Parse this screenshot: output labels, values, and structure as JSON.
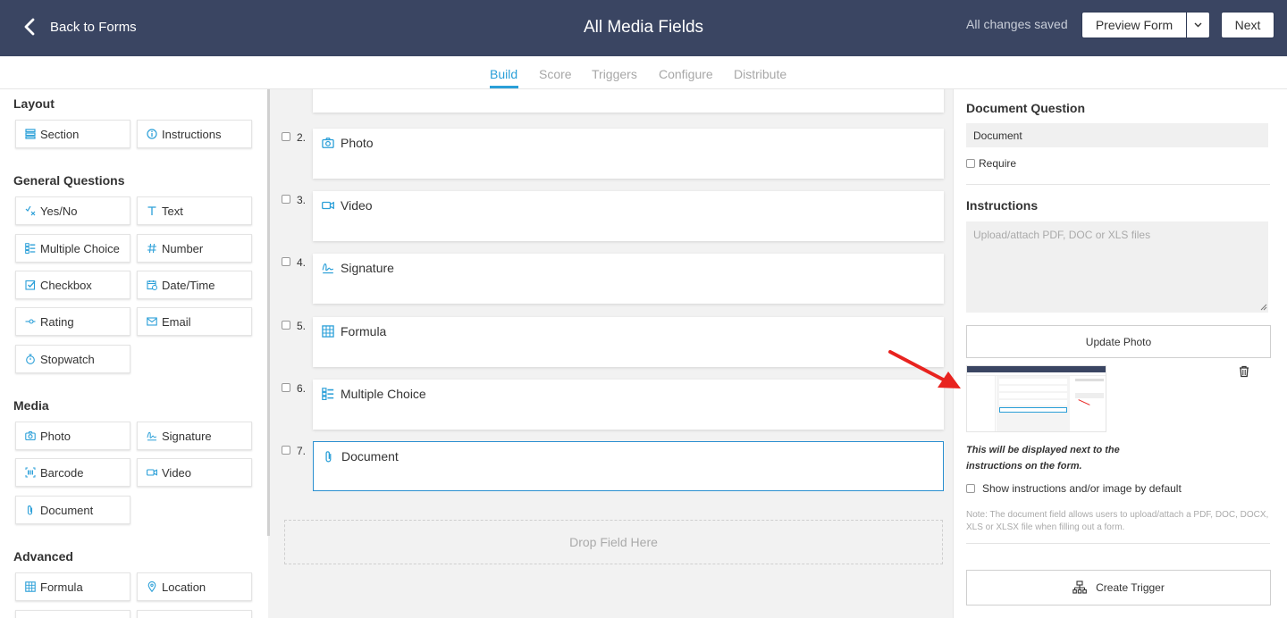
{
  "header": {
    "back_label": "Back to Forms",
    "title": "All Media Fields",
    "saved_status": "All changes saved",
    "preview_label": "Preview Form",
    "next_label": "Next"
  },
  "tabs": [
    {
      "label": "Build",
      "active": true
    },
    {
      "label": "Score"
    },
    {
      "label": "Triggers"
    },
    {
      "label": "Configure"
    },
    {
      "label": "Distribute"
    }
  ],
  "sidebar": {
    "layout_heading": "Layout",
    "layout_items": [
      {
        "label": "Section",
        "icon": "section-icon"
      },
      {
        "label": "Instructions",
        "icon": "info-icon"
      }
    ],
    "general_heading": "General Questions",
    "general_items": [
      {
        "label": "Yes/No",
        "icon": "yes-no-icon"
      },
      {
        "label": "Text",
        "icon": "text-icon"
      },
      {
        "label": "Multiple Choice",
        "icon": "multiple-choice-icon"
      },
      {
        "label": "Number",
        "icon": "hash-icon"
      },
      {
        "label": "Checkbox",
        "icon": "checkbox-icon"
      },
      {
        "label": "Date/Time",
        "icon": "calendar-icon"
      },
      {
        "label": "Rating",
        "icon": "rating-icon"
      },
      {
        "label": "Email",
        "icon": "email-icon"
      },
      {
        "label": "Stopwatch",
        "icon": "stopwatch-icon"
      }
    ],
    "media_heading": "Media",
    "media_items": [
      {
        "label": "Photo",
        "icon": "camera-icon"
      },
      {
        "label": "Signature",
        "icon": "signature-icon"
      },
      {
        "label": "Barcode",
        "icon": "barcode-icon"
      },
      {
        "label": "Video",
        "icon": "video-icon"
      },
      {
        "label": "Document",
        "icon": "paperclip-icon"
      }
    ],
    "advanced_heading": "Advanced",
    "advanced_items": [
      {
        "label": "Formula",
        "icon": "formula-icon"
      },
      {
        "label": "Location",
        "icon": "location-pin-icon"
      }
    ]
  },
  "questions": [
    {
      "number": "2.",
      "label": "Photo",
      "icon": "camera-icon"
    },
    {
      "number": "3.",
      "label": "Video",
      "icon": "video-icon"
    },
    {
      "number": "4.",
      "label": "Signature",
      "icon": "signature-icon"
    },
    {
      "number": "5.",
      "label": "Formula",
      "icon": "formula-icon"
    },
    {
      "number": "6.",
      "label": "Multiple Choice",
      "icon": "multiple-choice-icon"
    },
    {
      "number": "7.",
      "label": "Document",
      "icon": "paperclip-icon",
      "selected": true
    }
  ],
  "dropzone_label": "Drop Field Here",
  "right_panel": {
    "question_heading": "Document Question",
    "question_value": "Document",
    "require_label": "Require",
    "instructions_heading": "Instructions",
    "instructions_placeholder": "Upload/attach PDF, DOC or XLS files",
    "update_photo_label": "Update Photo",
    "display_note": "This will be displayed next to the instructions on the form.",
    "show_default_label": "Show instructions and/or image by default",
    "field_note": "Note: The document field allows users to upload/attach a PDF, DOC, DOCX, XLS or XLSX file when filling out a form.",
    "create_trigger_label": "Create Trigger"
  },
  "colors": {
    "header_bg": "#3a4562",
    "accent": "#2a9fd8",
    "annotation_arrow": "#e8231f"
  }
}
